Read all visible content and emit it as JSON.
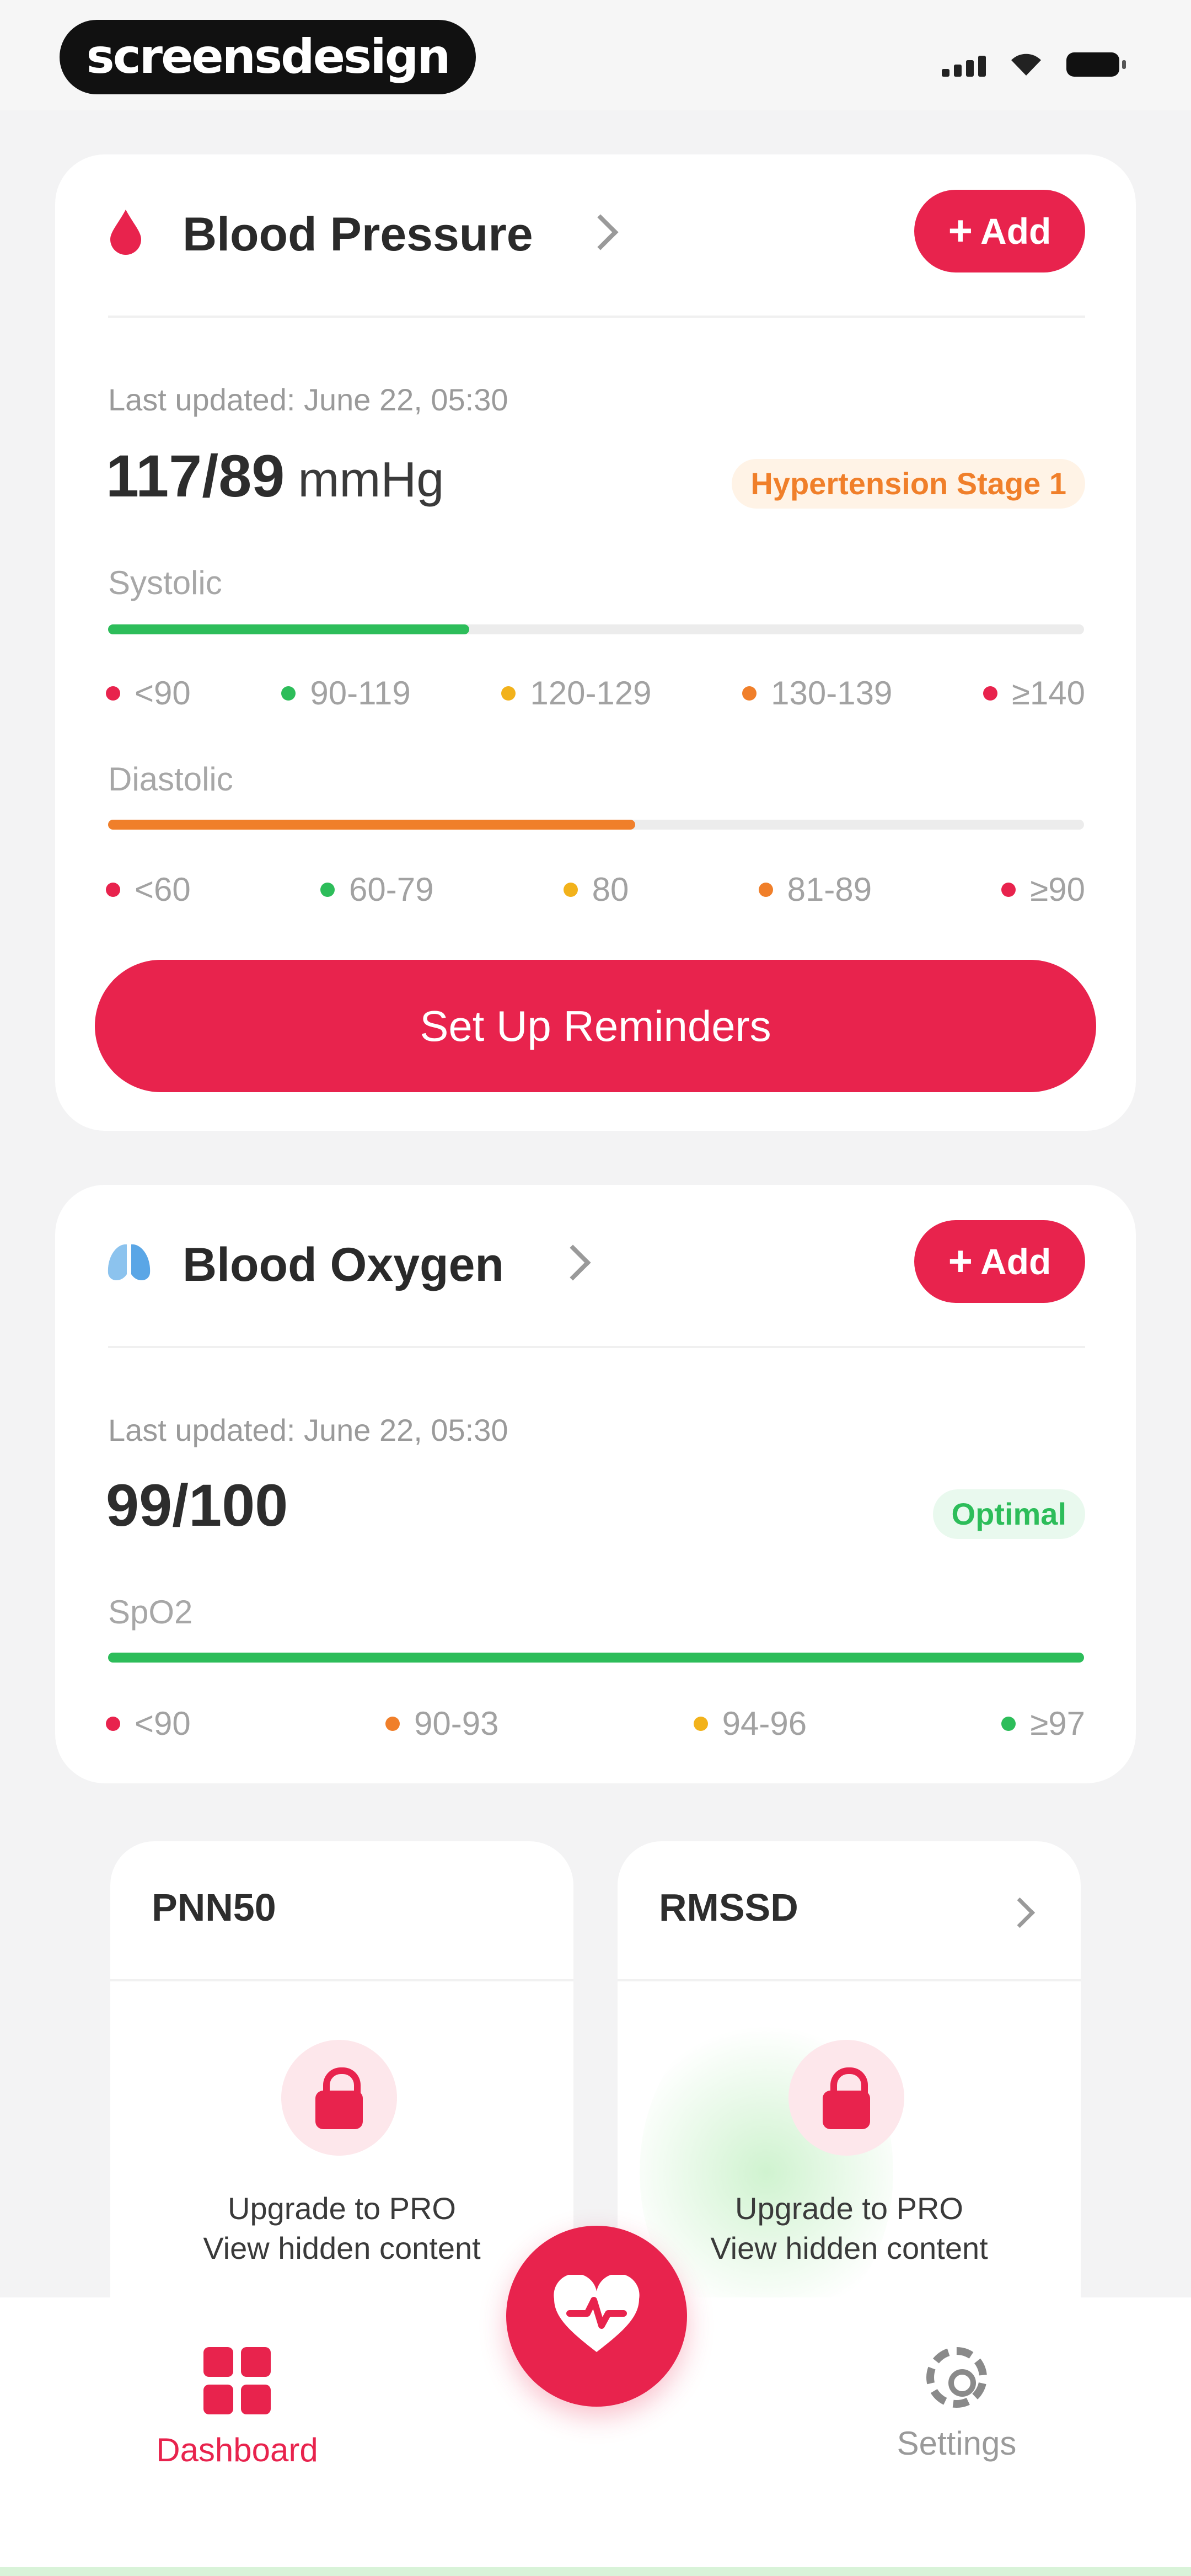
{
  "status_bar": {
    "watermark": "screensdesign"
  },
  "blood_pressure": {
    "title": "Blood Pressure",
    "add_label": "Add",
    "last_updated": "Last updated: June 22, 05:30",
    "value": "117/89",
    "unit": "mmHg",
    "status": "Hypertension Stage 1",
    "systolic": {
      "label": "Systolic",
      "fill_percent": 37,
      "fill_color": "#2dbd5a",
      "legend": [
        {
          "label": "<90",
          "color": "#e8234d"
        },
        {
          "label": "90-119",
          "color": "#2dbd5a"
        },
        {
          "label": "120-129",
          "color": "#f2b21b"
        },
        {
          "label": "130-139",
          "color": "#f07f2a"
        },
        {
          "label": "≥140",
          "color": "#e8234d"
        }
      ]
    },
    "diastolic": {
      "label": "Diastolic",
      "fill_percent": 54,
      "fill_color": "#f07f2a",
      "legend": [
        {
          "label": "<60",
          "color": "#e8234d"
        },
        {
          "label": "60-79",
          "color": "#2dbd5a"
        },
        {
          "label": "80",
          "color": "#f2b21b"
        },
        {
          "label": "81-89",
          "color": "#f07f2a"
        },
        {
          "label": "≥90",
          "color": "#e8234d"
        }
      ]
    },
    "reminder_button": "Set Up Reminders"
  },
  "blood_oxygen": {
    "title": "Blood Oxygen",
    "add_label": "Add",
    "last_updated": "Last updated: June 22, 05:30",
    "value": "99/100",
    "status": "Optimal",
    "spo2": {
      "label": "SpO2",
      "fill_percent": 100,
      "fill_color": "#2dbd5a",
      "legend": [
        {
          "label": "<90",
          "color": "#e8234d"
        },
        {
          "label": "90-93",
          "color": "#f07f2a"
        },
        {
          "label": "94-96",
          "color": "#f2b21b"
        },
        {
          "label": "≥97",
          "color": "#2dbd5a"
        }
      ]
    }
  },
  "locked_cards": [
    {
      "title": "PNN50",
      "line1": "Upgrade to PRO",
      "line2": "View hidden content"
    },
    {
      "title": "RMSSD",
      "line1": "Upgrade to PRO",
      "line2": "View hidden content"
    }
  ],
  "nav": {
    "dashboard": "Dashboard",
    "settings": "Settings"
  },
  "colors": {
    "accent": "#e8234d",
    "warning_text": "#f07f2a",
    "warning_bg": "#fff3e6",
    "optimal_text": "#2dbd5a",
    "optimal_bg": "#e9f9ee"
  }
}
